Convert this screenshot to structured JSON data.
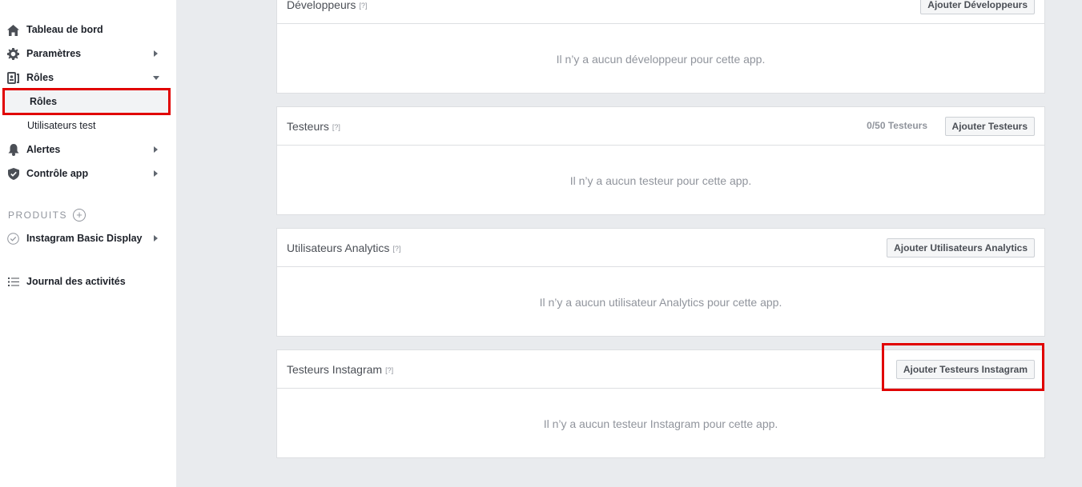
{
  "sidebar": {
    "items": [
      {
        "label": "Tableau de bord",
        "icon": "home-icon"
      },
      {
        "label": "Paramètres",
        "icon": "gear-icon"
      },
      {
        "label": "Rôles",
        "icon": "roles-icon"
      },
      {
        "label": "Alertes",
        "icon": "bell-icon"
      },
      {
        "label": "Contrôle app",
        "icon": "shield-icon"
      }
    ],
    "sub_items": [
      {
        "label": "Rôles",
        "active": true
      },
      {
        "label": "Utilisateurs test",
        "active": false
      }
    ],
    "products_label": "PRODUITS",
    "products": [
      {
        "label": "Instagram Basic Display",
        "icon": "check-circle-icon"
      }
    ],
    "activity_log": {
      "label": "Journal des activités",
      "icon": "list-icon"
    }
  },
  "cards": {
    "developers": {
      "title": "Développeurs",
      "help": "[?]",
      "button": "Ajouter Développeurs",
      "empty": "Il n’y a aucun développeur pour cette app."
    },
    "testers": {
      "title": "Testeurs",
      "help": "[?]",
      "count": "0/50 Testeurs",
      "button": "Ajouter Testeurs",
      "empty": "Il n’y a aucun testeur pour cette app."
    },
    "analytics": {
      "title": "Utilisateurs Analytics",
      "help": "[?]",
      "button": "Ajouter Utilisateurs Analytics",
      "empty": "Il n’y a aucun utilisateur Analytics pour cette app."
    },
    "instagram_testers": {
      "title": "Testeurs Instagram",
      "help": "[?]",
      "button": "Ajouter Testeurs Instagram",
      "empty": "Il n’y a aucun testeur Instagram pour cette app."
    }
  },
  "colors": {
    "highlight": "#e10000",
    "background": "#e9ebee"
  }
}
